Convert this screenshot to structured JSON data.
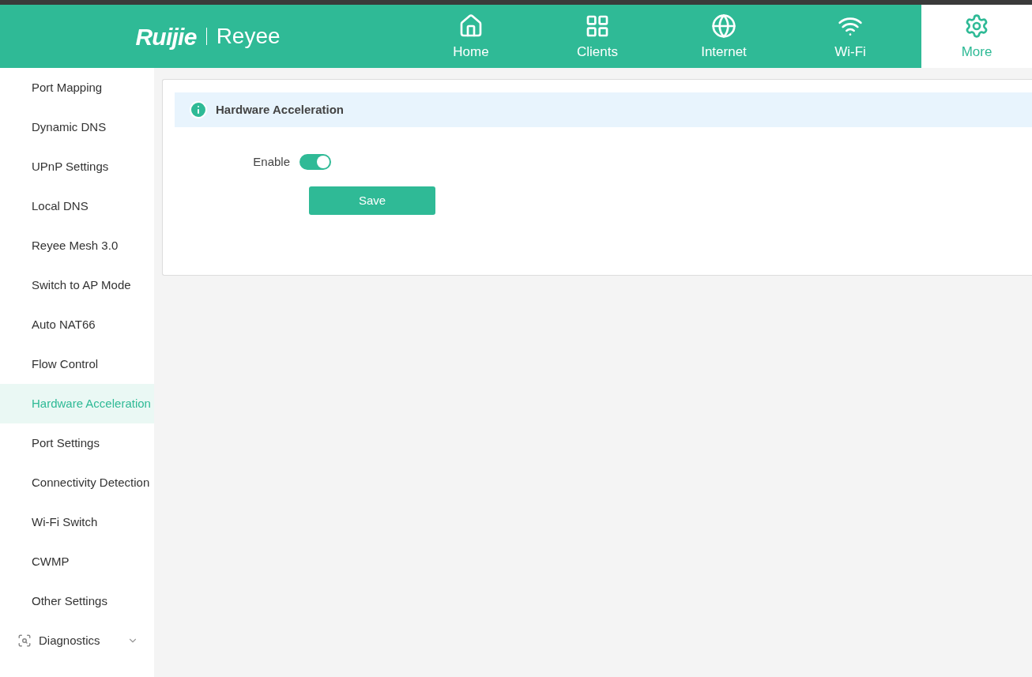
{
  "logo": {
    "brand": "Ruijie",
    "product": "Reyee"
  },
  "nav": [
    {
      "label": "Home",
      "kind": "home",
      "selected": false
    },
    {
      "label": "Clients",
      "kind": "clients",
      "selected": false
    },
    {
      "label": "Internet",
      "kind": "internet",
      "selected": false
    },
    {
      "label": "Wi-Fi",
      "kind": "wifi",
      "selected": false
    },
    {
      "label": "More",
      "kind": "more",
      "selected": true
    }
  ],
  "sidebar": {
    "items": [
      {
        "label": "Port Mapping",
        "selected": false
      },
      {
        "label": "Dynamic DNS",
        "selected": false
      },
      {
        "label": "UPnP Settings",
        "selected": false
      },
      {
        "label": "Local DNS",
        "selected": false
      },
      {
        "label": "Reyee Mesh 3.0",
        "selected": false
      },
      {
        "label": "Switch to AP Mode",
        "selected": false
      },
      {
        "label": "Auto NAT66",
        "selected": false
      },
      {
        "label": "Flow Control",
        "selected": false
      },
      {
        "label": "Hardware Acceleration",
        "selected": true
      },
      {
        "label": "Port Settings",
        "selected": false
      },
      {
        "label": "Connectivity Detection",
        "selected": false
      },
      {
        "label": "Wi-Fi Switch",
        "selected": false
      },
      {
        "label": "CWMP",
        "selected": false
      },
      {
        "label": "Other Settings",
        "selected": false
      }
    ],
    "group": {
      "label": "Diagnostics",
      "expanded": false
    }
  },
  "panel": {
    "title": "Hardware Acceleration",
    "enable_label": "Enable",
    "enable_on": true,
    "save_label": "Save"
  }
}
